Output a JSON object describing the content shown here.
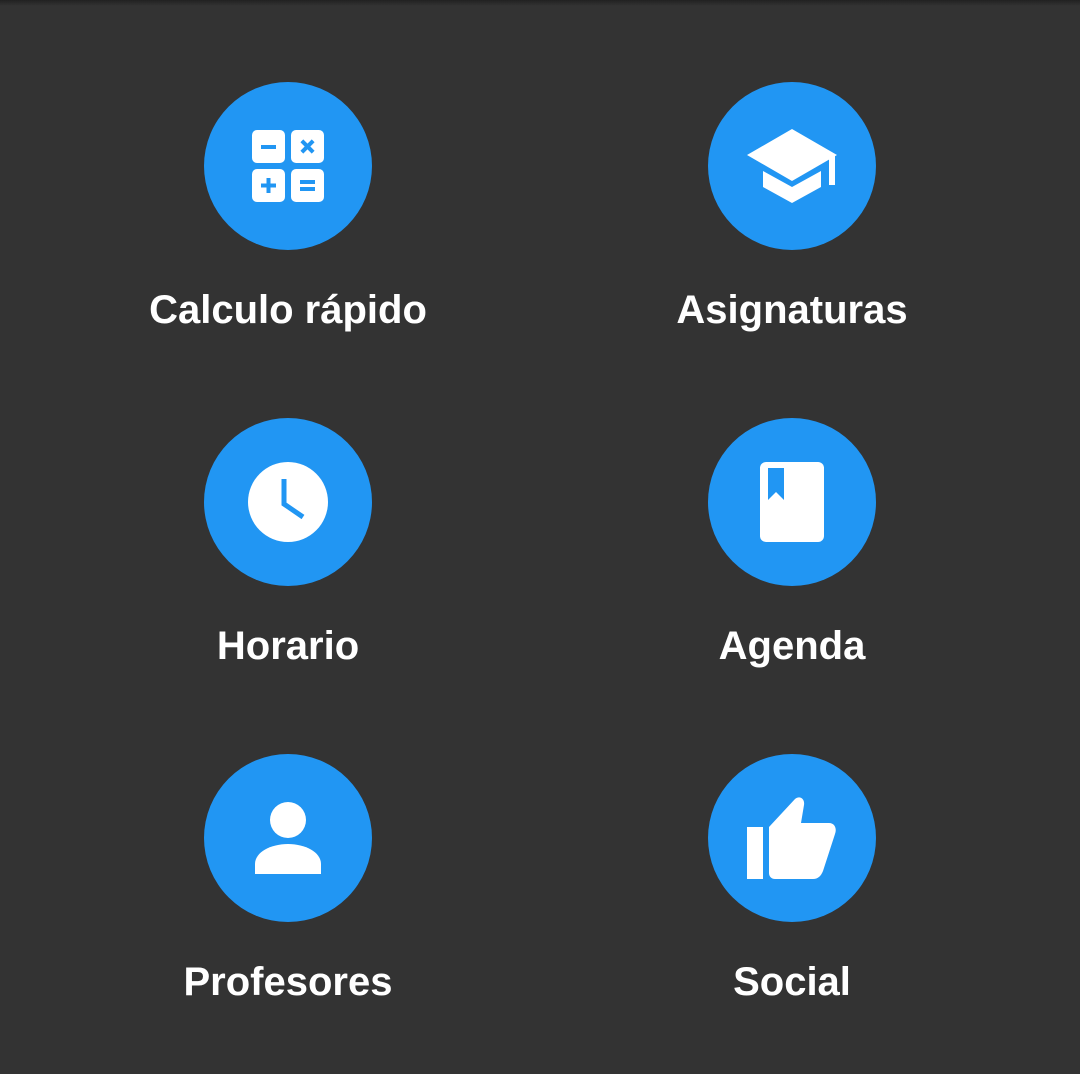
{
  "menu": {
    "items": [
      {
        "label": "Calculo rápido",
        "icon": "calculator-icon"
      },
      {
        "label": "Asignaturas",
        "icon": "graduation-cap-icon"
      },
      {
        "label": "Horario",
        "icon": "clock-icon"
      },
      {
        "label": "Agenda",
        "icon": "bookmark-book-icon"
      },
      {
        "label": "Profesores",
        "icon": "person-icon"
      },
      {
        "label": "Social",
        "icon": "thumbs-up-icon"
      }
    ]
  },
  "colors": {
    "background": "#333333",
    "accent": "#2196F3",
    "text": "#FFFFFF"
  }
}
